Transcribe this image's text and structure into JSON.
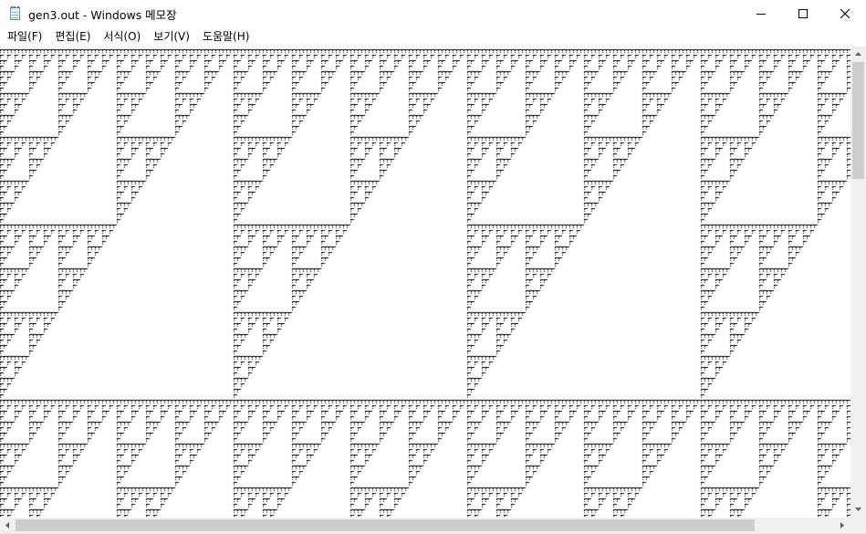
{
  "window": {
    "title": "gen3.out - Windows 메모장",
    "icon": "notepad-icon",
    "controls": [
      "minimize-icon",
      "maximize-icon",
      "close-icon"
    ]
  },
  "menu": {
    "file": "파일(F)",
    "edit": "편집(E)",
    "format": "서식(O)",
    "view": "보기(V)",
    "help": "도움말(H)"
  },
  "document": {
    "pattern": "sierpinski-triangle-text",
    "glyphs": [
      "_",
      ":"
    ]
  },
  "colors": {
    "text": "#000000",
    "background": "#ffffff",
    "scrollbar_track": "#f0f0f0",
    "scrollbar_thumb": "#cdcdcd"
  }
}
